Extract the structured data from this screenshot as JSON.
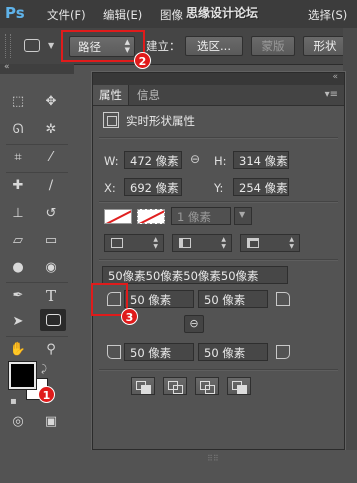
{
  "app": {
    "logo": "Ps"
  },
  "menu": {
    "items": [
      "文件(F)",
      "编辑(E)",
      "图像",
      "选择(S)"
    ],
    "watermark": "思缘设计论坛"
  },
  "options_bar": {
    "mode_select": "路径",
    "build_label": "建立：",
    "selection_button": "选区...",
    "mask_button": "蒙版",
    "shape_button": "形状",
    "tool_preset_icon": "rounded-rect-icon"
  },
  "toolbar": {
    "tools": [
      "rect-marquee-icon",
      "move-icon",
      "lasso-icon",
      "magic-wand-icon",
      "crop-icon",
      "eyedropper-icon",
      "spot-heal-icon",
      "brush-icon",
      "stamp-icon",
      "history-brush-icon",
      "eraser-icon",
      "gradient-icon",
      "blur-icon",
      "dodge-icon",
      "pen-icon",
      "type-icon",
      "path-select-icon",
      "rounded-rect-icon",
      "hand-icon",
      "zoom-icon",
      "quick-mask-icon",
      "screen-mode-icon"
    ],
    "fg_color": "#000000",
    "bg_color": "#ffffff"
  },
  "panel": {
    "tabs": [
      "属性",
      "信息"
    ],
    "active_tab": "属性",
    "title": "实时形状属性",
    "w_label": "W:",
    "w_value": "472 像素",
    "h_label": "H:",
    "h_value": "314 像素",
    "x_label": "X:",
    "x_value": "692 像素",
    "y_label": "Y:",
    "y_value": "254 像素",
    "stroke_width": "1 像素",
    "radii_summary": "50像素50像素50像素50像素",
    "radius_tl": "50 像素",
    "radius_tr": "50 像素",
    "radius_bl": "50 像素",
    "radius_br": "50 像素"
  },
  "annotations": {
    "badge1": "1",
    "badge2": "2",
    "badge3": "3",
    "color": "#e01b1b"
  }
}
